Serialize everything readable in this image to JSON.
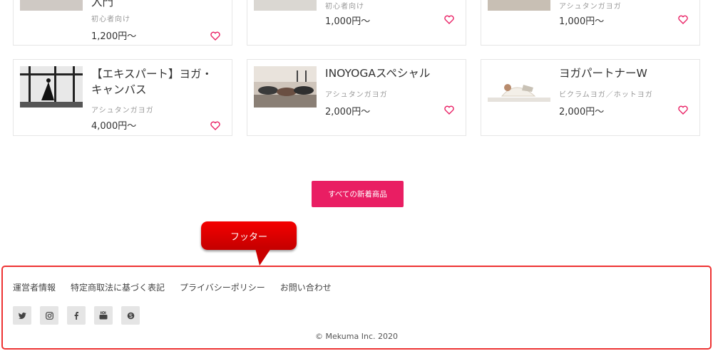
{
  "top_row": [
    {
      "title": "入門",
      "category": "初心者向け",
      "price": "1,200円〜"
    },
    {
      "title": "",
      "category": "初心者向け",
      "price": "1,000円〜"
    },
    {
      "title": "",
      "category": "アシュタンガヨガ",
      "price": "1,000円〜"
    }
  ],
  "products": [
    {
      "title": "【エキスパート】ヨガ・キャンバス",
      "category": "アシュタンガヨガ",
      "price": "4,000円〜"
    },
    {
      "title": "INOYOGAスペシャル",
      "category": "アシュタンガヨガ",
      "price": "2,000円〜"
    },
    {
      "title": "ヨガパートナーW",
      "category": "ビクラムヨガ／ホットヨガ",
      "price": "2,000円〜"
    }
  ],
  "more_button": "すべての新着商品",
  "callout": "フッター",
  "footer": {
    "links": [
      "運営者情報",
      "特定商取法に基づく表記",
      "プライバシーポリシー",
      "お問い合わせ"
    ],
    "social": [
      "twitter-icon",
      "instagram-icon",
      "facebook-icon",
      "youtube-icon",
      "skype-icon"
    ],
    "copyright": "© Mekuma Inc. 2020"
  },
  "colors": {
    "accent": "#e91e63",
    "callout": "#e00000",
    "heart": "#e91e63"
  }
}
